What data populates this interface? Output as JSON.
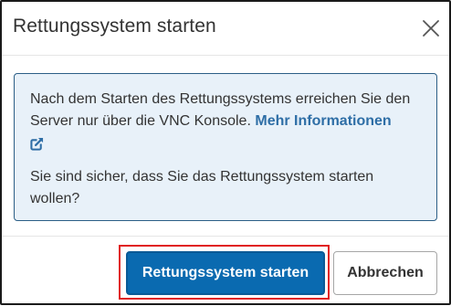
{
  "dialog": {
    "title": "Rettungssystem starten",
    "close_icon": "close-icon"
  },
  "info": {
    "message_part1": "Nach dem Starten des Rettungssystems erreichen Sie den Server nur über die VNC Konsole.",
    "link_label": "Mehr Informationen",
    "link_icon": "external-link-icon",
    "question": "Sie sind sicher, dass Sie das Rettungssystem starten wollen?"
  },
  "footer": {
    "confirm_label": "Rettungssystem starten",
    "cancel_label": "Abbrechen"
  },
  "colors": {
    "primary": "#0a6ab0",
    "link": "#2e6ea6",
    "info_background": "#e8f1f9",
    "info_border": "#2b5e86",
    "highlight": "#e02020"
  }
}
